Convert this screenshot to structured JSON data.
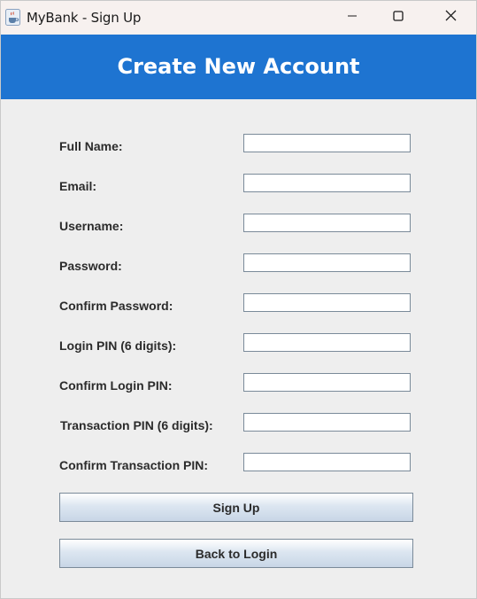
{
  "window": {
    "title": "MyBank - Sign Up",
    "app_icon": "java-cup-icon",
    "controls": [
      "minimize-icon",
      "maximize-icon",
      "close-icon"
    ]
  },
  "header": {
    "title": "Create New Account",
    "background": "#1e74d1"
  },
  "form": {
    "fields": [
      {
        "label": "Full Name:",
        "value": ""
      },
      {
        "label": "Email:",
        "value": ""
      },
      {
        "label": "Username:",
        "value": ""
      },
      {
        "label": "Password:",
        "value": ""
      },
      {
        "label": "Confirm Password:",
        "value": ""
      },
      {
        "label": "Login PIN (6 digits):",
        "value": ""
      },
      {
        "label": "Confirm Login PIN:",
        "value": ""
      },
      {
        "label": "Transaction PIN (6 digits):",
        "value": ""
      },
      {
        "label": "Confirm Transaction PIN:",
        "value": ""
      }
    ]
  },
  "buttons": {
    "sign_up": "Sign Up",
    "back_to_login": "Back to Login"
  }
}
